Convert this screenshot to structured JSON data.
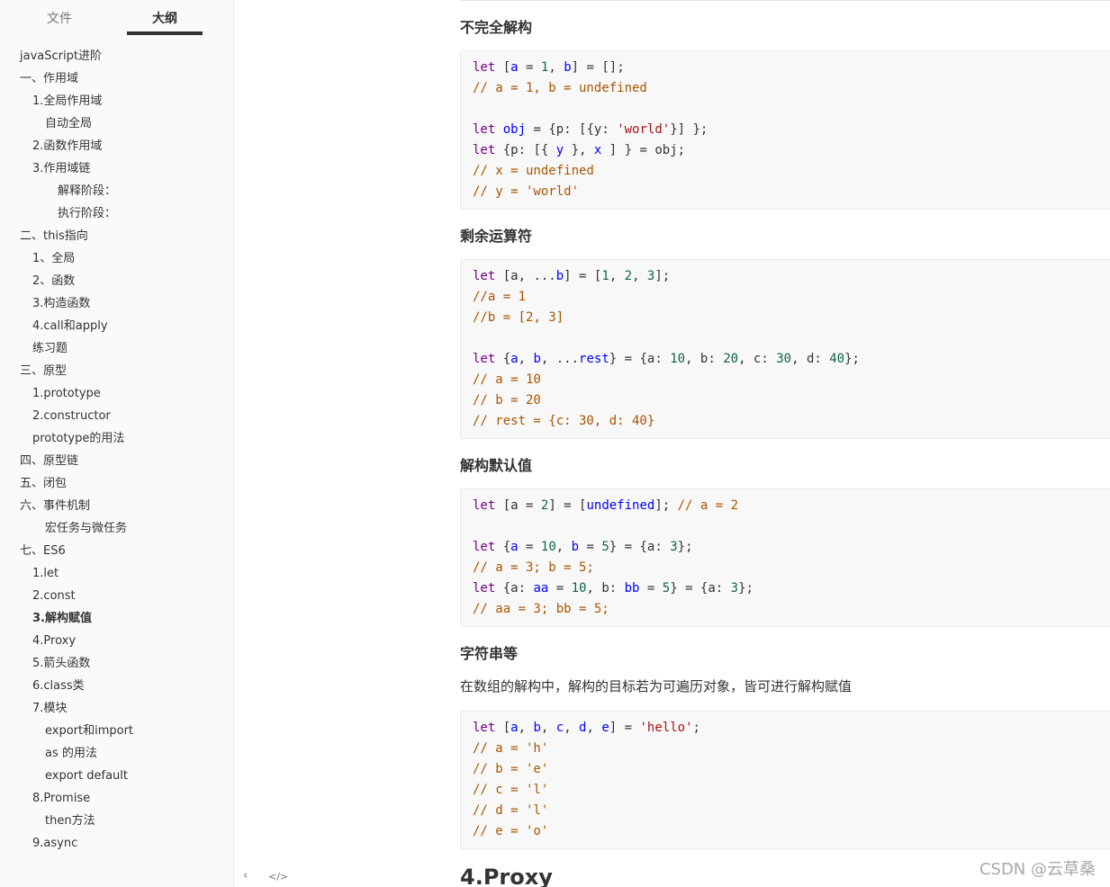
{
  "sidebar": {
    "tabs": [
      "文件",
      "大纲"
    ],
    "active_tab": "大纲",
    "outline": [
      {
        "label": "javaScript进阶",
        "level": 0
      },
      {
        "label": "一、作用域",
        "level": 0
      },
      {
        "label": "1.全局作用域",
        "level": 1
      },
      {
        "label": "自动全局",
        "level": 2
      },
      {
        "label": "2.函数作用域",
        "level": 1
      },
      {
        "label": "3.作用域链",
        "level": 1
      },
      {
        "label": "解释阶段：",
        "level": 3
      },
      {
        "label": "执行阶段：",
        "level": 3
      },
      {
        "label": "二、this指向",
        "level": 0
      },
      {
        "label": "1、全局",
        "level": 1
      },
      {
        "label": "2、函数",
        "level": 1
      },
      {
        "label": "3.构造函数",
        "level": 1
      },
      {
        "label": "4.call和apply",
        "level": 1
      },
      {
        "label": "练习题",
        "level": 1
      },
      {
        "label": "三、原型",
        "level": 0
      },
      {
        "label": "1.prototype",
        "level": 1
      },
      {
        "label": "2.constructor",
        "level": 1
      },
      {
        "label": "prototype的用法",
        "level": 1
      },
      {
        "label": "四、原型链",
        "level": 0
      },
      {
        "label": "五、闭包",
        "level": 0
      },
      {
        "label": "六、事件机制",
        "level": 0
      },
      {
        "label": "宏任务与微任务",
        "level": 2
      },
      {
        "label": "七、ES6",
        "level": 0
      },
      {
        "label": "1.let",
        "level": 1
      },
      {
        "label": "2.const",
        "level": 1
      },
      {
        "label": "3.解构赋值",
        "level": 1,
        "active": true
      },
      {
        "label": "4.Proxy",
        "level": 1
      },
      {
        "label": "5.箭头函数",
        "level": 1
      },
      {
        "label": "6.class类",
        "level": 1
      },
      {
        "label": "7.模块",
        "level": 1
      },
      {
        "label": "export和import",
        "level": 2
      },
      {
        "label": "as 的用法",
        "level": 2
      },
      {
        "label": "export default",
        "level": 2
      },
      {
        "label": "8.Promise",
        "level": 1
      },
      {
        "label": "then方法",
        "level": 2
      },
      {
        "label": "9.async",
        "level": 1
      }
    ],
    "footer": {
      "collapse_icon": "‹",
      "source_icon": "</>"
    }
  },
  "content": {
    "sections": [
      {
        "heading": "不完全解构",
        "code": [
          [
            [
              "kw",
              "let"
            ],
            [
              "p",
              " ["
            ],
            [
              "var",
              "a"
            ],
            [
              "p",
              " = "
            ],
            [
              "num",
              "1"
            ],
            [
              "p",
              ", "
            ],
            [
              "var",
              "b"
            ],
            [
              "p",
              "] = [];"
            ]
          ],
          [
            [
              "com",
              "// a = 1, b = undefined"
            ]
          ],
          [
            [
              "p",
              ""
            ]
          ],
          [
            [
              "kw",
              "let"
            ],
            [
              "p",
              " "
            ],
            [
              "var",
              "obj"
            ],
            [
              "p",
              " = {p: [{y: "
            ],
            [
              "str",
              "'world'"
            ],
            [
              "p",
              "}] };"
            ]
          ],
          [
            [
              "kw",
              "let"
            ],
            [
              "p",
              " {p: [{ "
            ],
            [
              "var",
              "y"
            ],
            [
              "p",
              " }, "
            ],
            [
              "var",
              "x"
            ],
            [
              "p",
              " ] } = obj;"
            ]
          ],
          [
            [
              "com",
              "// x = undefined"
            ]
          ],
          [
            [
              "com",
              "// y = 'world'"
            ]
          ]
        ]
      },
      {
        "heading": "剩余运算符",
        "code": [
          [
            [
              "kw",
              "let"
            ],
            [
              "p",
              " [a, ..."
            ],
            [
              "var",
              "b"
            ],
            [
              "p",
              "] = ["
            ],
            [
              "num",
              "1"
            ],
            [
              "p",
              ", "
            ],
            [
              "num",
              "2"
            ],
            [
              "p",
              ", "
            ],
            [
              "num",
              "3"
            ],
            [
              "p",
              "];"
            ]
          ],
          [
            [
              "com",
              "//a = 1"
            ]
          ],
          [
            [
              "com",
              "//b = [2, 3]"
            ]
          ],
          [
            [
              "p",
              ""
            ]
          ],
          [
            [
              "kw",
              "let"
            ],
            [
              "p",
              " {"
            ],
            [
              "var",
              "a"
            ],
            [
              "p",
              ", "
            ],
            [
              "var",
              "b"
            ],
            [
              "p",
              ", ..."
            ],
            [
              "var",
              "rest"
            ],
            [
              "p",
              "} = {a: "
            ],
            [
              "num",
              "10"
            ],
            [
              "p",
              ", b: "
            ],
            [
              "num",
              "20"
            ],
            [
              "p",
              ", c: "
            ],
            [
              "num",
              "30"
            ],
            [
              "p",
              ", d: "
            ],
            [
              "num",
              "40"
            ],
            [
              "p",
              "};"
            ]
          ],
          [
            [
              "com",
              "// a = 10"
            ]
          ],
          [
            [
              "com",
              "// b = 20"
            ]
          ],
          [
            [
              "com",
              "// rest = {c: 30, d: 40}"
            ]
          ]
        ]
      },
      {
        "heading": "解构默认值",
        "code": [
          [
            [
              "kw",
              "let"
            ],
            [
              "p",
              " [a = "
            ],
            [
              "num",
              "2"
            ],
            [
              "p",
              "] = ["
            ],
            [
              "var",
              "undefined"
            ],
            [
              "p",
              "]; "
            ],
            [
              "com",
              "// a = 2"
            ]
          ],
          [
            [
              "p",
              ""
            ]
          ],
          [
            [
              "kw",
              "let"
            ],
            [
              "p",
              " {"
            ],
            [
              "var",
              "a"
            ],
            [
              "p",
              " = "
            ],
            [
              "num",
              "10"
            ],
            [
              "p",
              ", "
            ],
            [
              "var",
              "b"
            ],
            [
              "p",
              " = "
            ],
            [
              "num",
              "5"
            ],
            [
              "p",
              "} = {a: "
            ],
            [
              "num",
              "3"
            ],
            [
              "p",
              "};"
            ]
          ],
          [
            [
              "com",
              "// a = 3; b = 5;"
            ]
          ],
          [
            [
              "kw",
              "let"
            ],
            [
              "p",
              " {a: "
            ],
            [
              "var",
              "aa"
            ],
            [
              "p",
              " = "
            ],
            [
              "num",
              "10"
            ],
            [
              "p",
              ", b: "
            ],
            [
              "var",
              "bb"
            ],
            [
              "p",
              " = "
            ],
            [
              "num",
              "5"
            ],
            [
              "p",
              "} = {a: "
            ],
            [
              "num",
              "3"
            ],
            [
              "p",
              "};"
            ]
          ],
          [
            [
              "com",
              "// aa = 3; bb = 5;"
            ]
          ]
        ]
      },
      {
        "heading": "字符串等",
        "paragraph": "在数组的解构中，解构的目标若为可遍历对象，皆可进行解构赋值",
        "code": [
          [
            [
              "kw",
              "let"
            ],
            [
              "p",
              " ["
            ],
            [
              "var",
              "a"
            ],
            [
              "p",
              ", "
            ],
            [
              "var",
              "b"
            ],
            [
              "p",
              ", "
            ],
            [
              "var",
              "c"
            ],
            [
              "p",
              ", "
            ],
            [
              "var",
              "d"
            ],
            [
              "p",
              ", "
            ],
            [
              "var",
              "e"
            ],
            [
              "p",
              "] = "
            ],
            [
              "str",
              "'hello'"
            ],
            [
              "p",
              ";"
            ]
          ],
          [
            [
              "com",
              "// a = 'h'"
            ]
          ],
          [
            [
              "com",
              "// b = 'e'"
            ]
          ],
          [
            [
              "com",
              "// c = 'l'"
            ]
          ],
          [
            [
              "com",
              "// d = 'l'"
            ]
          ],
          [
            [
              "com",
              "// e = 'o'"
            ]
          ]
        ]
      }
    ],
    "next_heading": "4.Proxy"
  },
  "watermark": "CSDN @云草桑"
}
